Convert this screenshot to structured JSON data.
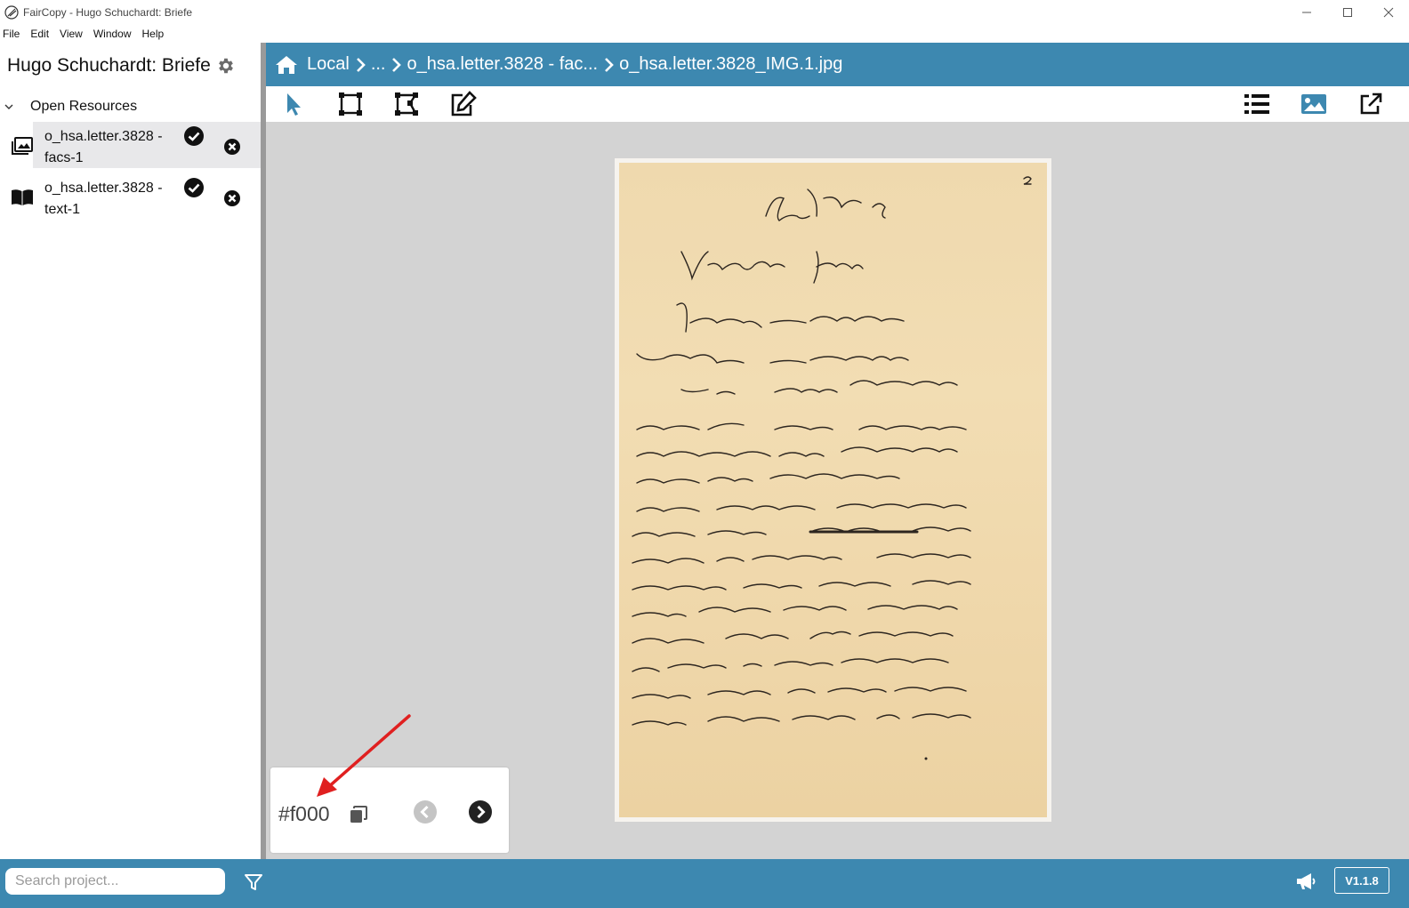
{
  "window": {
    "title": "FairCopy - Hugo Schuchardt: Briefe"
  },
  "menu": [
    "File",
    "Edit",
    "View",
    "Window",
    "Help"
  ],
  "sidebar": {
    "project_title": "Hugo Schuchardt: Briefe",
    "section_label": "Open Resources",
    "resources": [
      {
        "line1": "o_hsa.letter.3828 -",
        "line2": "facs-1",
        "type_icon": "facsimile-icon",
        "active": true
      },
      {
        "line1": "o_hsa.letter.3828 -",
        "line2": "text-1",
        "type_icon": "book-icon",
        "active": false
      }
    ]
  },
  "breadcrumb": {
    "items": [
      "Local",
      "...",
      "o_hsa.letter.3828 - fac...",
      "o_hsa.letter.3828_IMG.1.jpg"
    ]
  },
  "toolbar": {
    "left_tools": [
      "pointer-icon",
      "rectangle-zone-icon",
      "polygon-zone-icon",
      "edit-icon"
    ],
    "right_tools": [
      "list-icon",
      "image-icon",
      "popout-icon"
    ]
  },
  "zone_panel": {
    "zone_id": "#f000"
  },
  "footer": {
    "search_placeholder": "Search project...",
    "version": "V1.1.8"
  },
  "colors": {
    "brand": "#3d88b0",
    "canvas": "#d3d3d3",
    "annotation_arrow": "#e02020"
  }
}
